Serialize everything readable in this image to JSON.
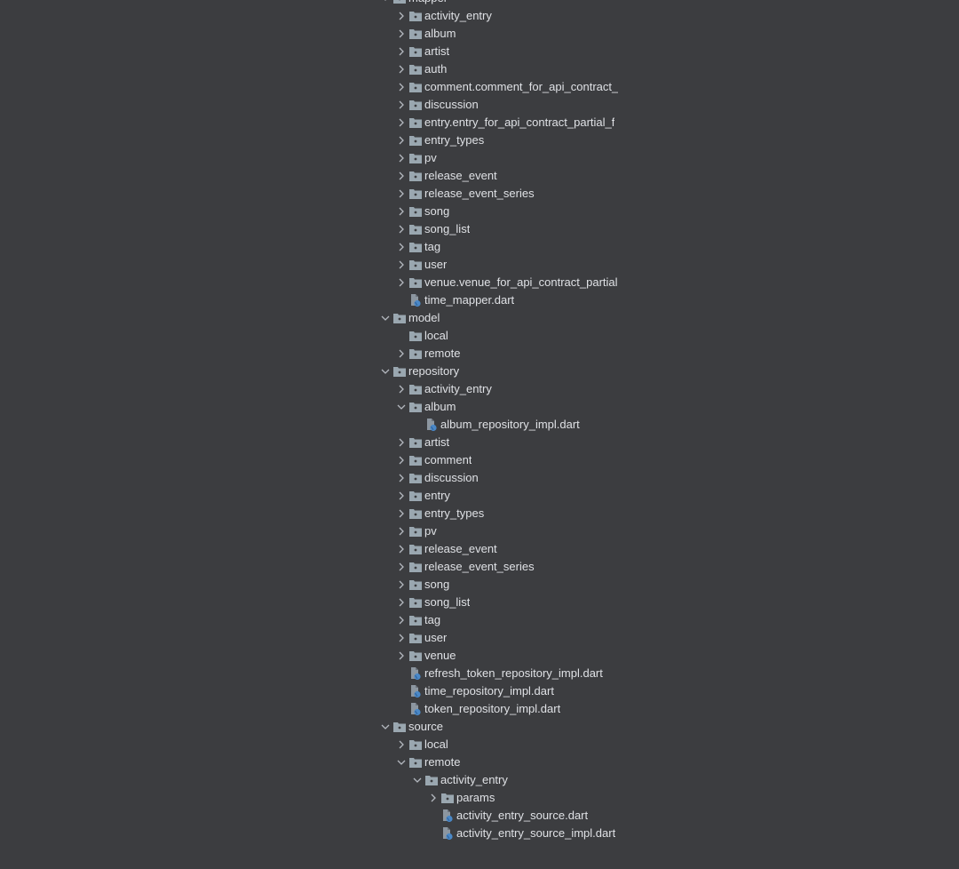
{
  "tree": [
    {
      "label": "mapper",
      "type": "folder",
      "depth": 1,
      "state": "expanded",
      "partial": true
    },
    {
      "label": "activity_entry",
      "type": "folder",
      "depth": 2,
      "state": "collapsed"
    },
    {
      "label": "album",
      "type": "folder",
      "depth": 2,
      "state": "collapsed"
    },
    {
      "label": "artist",
      "type": "folder",
      "depth": 2,
      "state": "collapsed"
    },
    {
      "label": "auth",
      "type": "folder",
      "depth": 2,
      "state": "collapsed"
    },
    {
      "label": "comment.comment_for_api_contract_",
      "type": "folder",
      "depth": 2,
      "state": "collapsed"
    },
    {
      "label": "discussion",
      "type": "folder",
      "depth": 2,
      "state": "collapsed"
    },
    {
      "label": "entry.entry_for_api_contract_partial_f",
      "type": "folder",
      "depth": 2,
      "state": "collapsed"
    },
    {
      "label": "entry_types",
      "type": "folder",
      "depth": 2,
      "state": "collapsed"
    },
    {
      "label": "pv",
      "type": "folder",
      "depth": 2,
      "state": "collapsed"
    },
    {
      "label": "release_event",
      "type": "folder",
      "depth": 2,
      "state": "collapsed"
    },
    {
      "label": "release_event_series",
      "type": "folder",
      "depth": 2,
      "state": "collapsed"
    },
    {
      "label": "song",
      "type": "folder",
      "depth": 2,
      "state": "collapsed"
    },
    {
      "label": "song_list",
      "type": "folder",
      "depth": 2,
      "state": "collapsed"
    },
    {
      "label": "tag",
      "type": "folder",
      "depth": 2,
      "state": "collapsed"
    },
    {
      "label": "user",
      "type": "folder",
      "depth": 2,
      "state": "collapsed"
    },
    {
      "label": "venue.venue_for_api_contract_partial",
      "type": "folder",
      "depth": 2,
      "state": "collapsed"
    },
    {
      "label": "time_mapper.dart",
      "type": "dart-file",
      "depth": 2,
      "state": "leaf"
    },
    {
      "label": "model",
      "type": "folder",
      "depth": 1,
      "state": "expanded"
    },
    {
      "label": "local",
      "type": "folder",
      "depth": 2,
      "state": "empty"
    },
    {
      "label": "remote",
      "type": "folder",
      "depth": 2,
      "state": "collapsed"
    },
    {
      "label": "repository",
      "type": "folder",
      "depth": 1,
      "state": "expanded"
    },
    {
      "label": "activity_entry",
      "type": "folder",
      "depth": 2,
      "state": "collapsed"
    },
    {
      "label": "album",
      "type": "folder",
      "depth": 2,
      "state": "expanded"
    },
    {
      "label": "album_repository_impl.dart",
      "type": "dart-file",
      "depth": 3,
      "state": "leaf"
    },
    {
      "label": "artist",
      "type": "folder",
      "depth": 2,
      "state": "collapsed"
    },
    {
      "label": "comment",
      "type": "folder",
      "depth": 2,
      "state": "collapsed"
    },
    {
      "label": "discussion",
      "type": "folder",
      "depth": 2,
      "state": "collapsed"
    },
    {
      "label": "entry",
      "type": "folder",
      "depth": 2,
      "state": "collapsed"
    },
    {
      "label": "entry_types",
      "type": "folder",
      "depth": 2,
      "state": "collapsed"
    },
    {
      "label": "pv",
      "type": "folder",
      "depth": 2,
      "state": "collapsed"
    },
    {
      "label": "release_event",
      "type": "folder",
      "depth": 2,
      "state": "collapsed"
    },
    {
      "label": "release_event_series",
      "type": "folder",
      "depth": 2,
      "state": "collapsed"
    },
    {
      "label": "song",
      "type": "folder",
      "depth": 2,
      "state": "collapsed"
    },
    {
      "label": "song_list",
      "type": "folder",
      "depth": 2,
      "state": "collapsed"
    },
    {
      "label": "tag",
      "type": "folder",
      "depth": 2,
      "state": "collapsed"
    },
    {
      "label": "user",
      "type": "folder",
      "depth": 2,
      "state": "collapsed"
    },
    {
      "label": "venue",
      "type": "folder",
      "depth": 2,
      "state": "collapsed"
    },
    {
      "label": "refresh_token_repository_impl.dart",
      "type": "dart-file",
      "depth": 2,
      "state": "leaf"
    },
    {
      "label": "time_repository_impl.dart",
      "type": "dart-file",
      "depth": 2,
      "state": "leaf"
    },
    {
      "label": "token_repository_impl.dart",
      "type": "dart-file",
      "depth": 2,
      "state": "leaf"
    },
    {
      "label": "source",
      "type": "folder",
      "depth": 1,
      "state": "expanded"
    },
    {
      "label": "local",
      "type": "folder",
      "depth": 2,
      "state": "collapsed"
    },
    {
      "label": "remote",
      "type": "folder",
      "depth": 2,
      "state": "expanded"
    },
    {
      "label": "activity_entry",
      "type": "folder",
      "depth": 3,
      "state": "expanded"
    },
    {
      "label": "params",
      "type": "folder",
      "depth": 4,
      "state": "collapsed"
    },
    {
      "label": "activity_entry_source.dart",
      "type": "dart-file",
      "depth": 4,
      "state": "leaf"
    },
    {
      "label": "activity_entry_source_impl.dart",
      "type": "dart-file",
      "depth": 4,
      "state": "leaf"
    }
  ],
  "colors": {
    "background": "#3c3d40",
    "text": "#dfe1e5",
    "folder": "#9aa7b0",
    "chevron": "#b4b8bf",
    "dart_badge": "#4a88c7"
  }
}
